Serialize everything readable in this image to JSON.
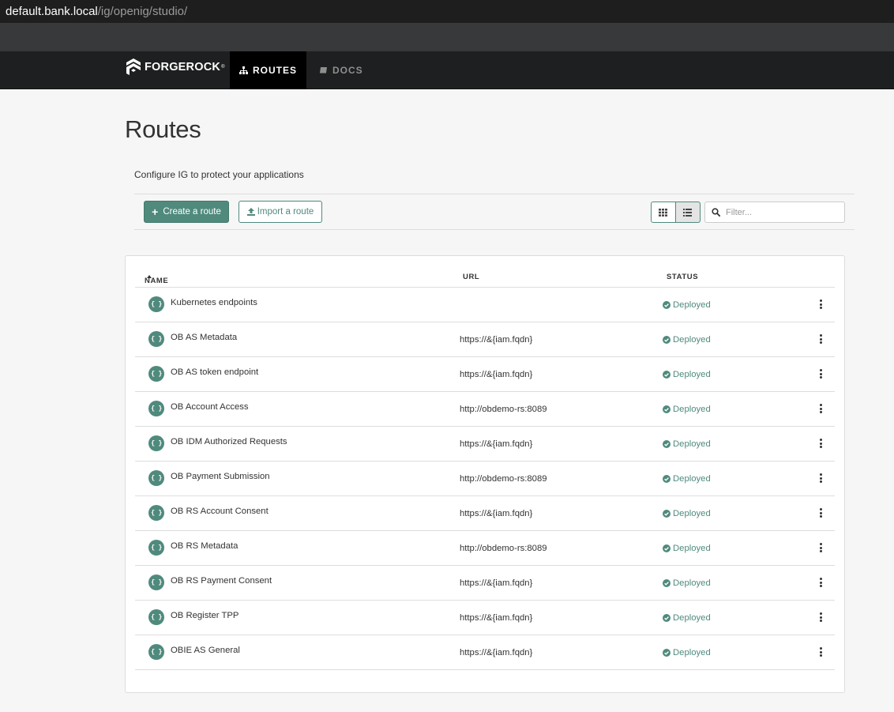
{
  "browser": {
    "url_host": "default.bank.local",
    "url_path": "/ig/openig/studio/"
  },
  "nav": {
    "brand": "FORGEROCK",
    "brand_mark": "®",
    "items": [
      {
        "label": "ROUTES",
        "icon": "sitemap-icon",
        "active": true
      },
      {
        "label": "DOCS",
        "icon": "book-icon",
        "active": false
      }
    ]
  },
  "page": {
    "title": "Routes",
    "subtitle": "Configure IG to protect your applications"
  },
  "actions": {
    "create_label": "Create a route",
    "import_label": "Import a route",
    "filter_placeholder": "Filter...",
    "view_mode": "list"
  },
  "table": {
    "columns": {
      "name": "NAME",
      "url": "URL",
      "status": "STATUS"
    },
    "sort": {
      "column": "name",
      "direction": "asc"
    },
    "rows": [
      {
        "name": "Kubernetes endpoints",
        "url": "",
        "status": "Deployed"
      },
      {
        "name": "OB AS Metadata",
        "url": "https://&{iam.fqdn}",
        "status": "Deployed"
      },
      {
        "name": "OB AS token endpoint",
        "url": "https://&{iam.fqdn}",
        "status": "Deployed"
      },
      {
        "name": "OB Account Access",
        "url": "http://obdemo-rs:8089",
        "status": "Deployed"
      },
      {
        "name": "OB IDM Authorized Requests",
        "url": "https://&{iam.fqdn}",
        "status": "Deployed"
      },
      {
        "name": "OB Payment Submission",
        "url": "http://obdemo-rs:8089",
        "status": "Deployed"
      },
      {
        "name": "OB RS Account Consent",
        "url": "https://&{iam.fqdn}",
        "status": "Deployed"
      },
      {
        "name": "OB RS Metadata",
        "url": "http://obdemo-rs:8089",
        "status": "Deployed"
      },
      {
        "name": "OB RS Payment Consent",
        "url": "https://&{iam.fqdn}",
        "status": "Deployed"
      },
      {
        "name": "OB Register TPP",
        "url": "https://&{iam.fqdn}",
        "status": "Deployed"
      },
      {
        "name": "OBIE AS General",
        "url": "https://&{iam.fqdn}",
        "status": "Deployed"
      }
    ],
    "route_icon_glyph": "{ }"
  },
  "colors": {
    "accent": "#4f8a7d",
    "navbar": "#1e1f20",
    "page_bg": "#f6f6f6"
  }
}
